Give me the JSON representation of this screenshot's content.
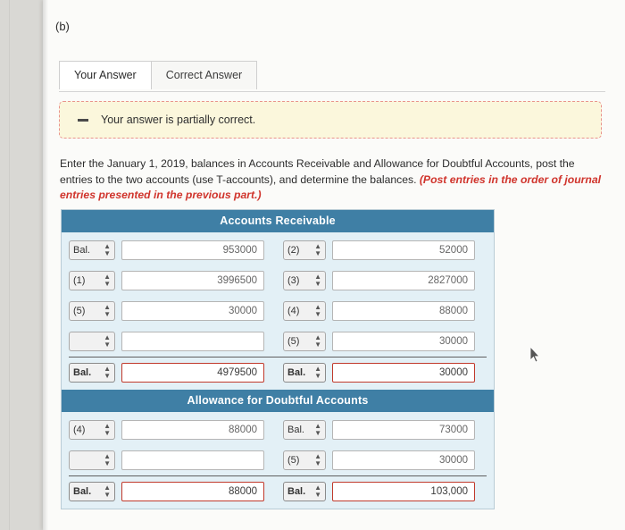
{
  "part_label": "(b)",
  "tabs": [
    {
      "label": "Your Answer",
      "active": true
    },
    {
      "label": "Correct Answer",
      "active": false
    }
  ],
  "alert": {
    "icon": "minus-icon",
    "text": "Your answer is partially correct."
  },
  "instructions": {
    "text_1": "Enter the January 1, 2019, balances in Accounts Receivable and Allowance for Doubtful Accounts, post the entries to the two accounts (use T-accounts), and determine the balances. ",
    "emphasis": "(Post entries in the order of journal entries presented in the previous part.)"
  },
  "accounts": [
    {
      "title": "Accounts Receivable",
      "rows": [
        {
          "left_label": "Bal.",
          "left_amount": "953000",
          "right_label": "(2)",
          "right_amount": "52000"
        },
        {
          "left_label": "(1)",
          "left_amount": "3996500",
          "right_label": "(3)",
          "right_amount": "2827000"
        },
        {
          "left_label": "(5)",
          "left_amount": "30000",
          "right_label": "(4)",
          "right_amount": "88000"
        },
        {
          "left_label": "",
          "left_amount": "",
          "right_label": "(5)",
          "right_amount": "30000"
        },
        {
          "left_label": "Bal.",
          "left_amount": "4979500",
          "right_label": "Bal.",
          "right_amount": "30000",
          "total": true
        }
      ]
    },
    {
      "title": "Allowance for Doubtful Accounts",
      "rows": [
        {
          "left_label": "(4)",
          "left_amount": "88000",
          "right_label": "Bal.",
          "right_amount": "73000"
        },
        {
          "left_label": "",
          "left_amount": "",
          "right_label": "(5)",
          "right_amount": "30000"
        },
        {
          "left_label": "Bal.",
          "left_amount": "88000",
          "right_label": "Bal.",
          "right_amount": "103,000",
          "total": true
        }
      ]
    }
  ],
  "colors": {
    "header_blue": "#3f7fa5",
    "panel_blue": "#e3f0f6",
    "alert_bg": "#fbf7dc",
    "alert_border": "#e9938d",
    "emphasis_red": "#d0342c",
    "input_red": "#c0392b"
  },
  "cursor": {
    "name": "mouse-pointer"
  }
}
